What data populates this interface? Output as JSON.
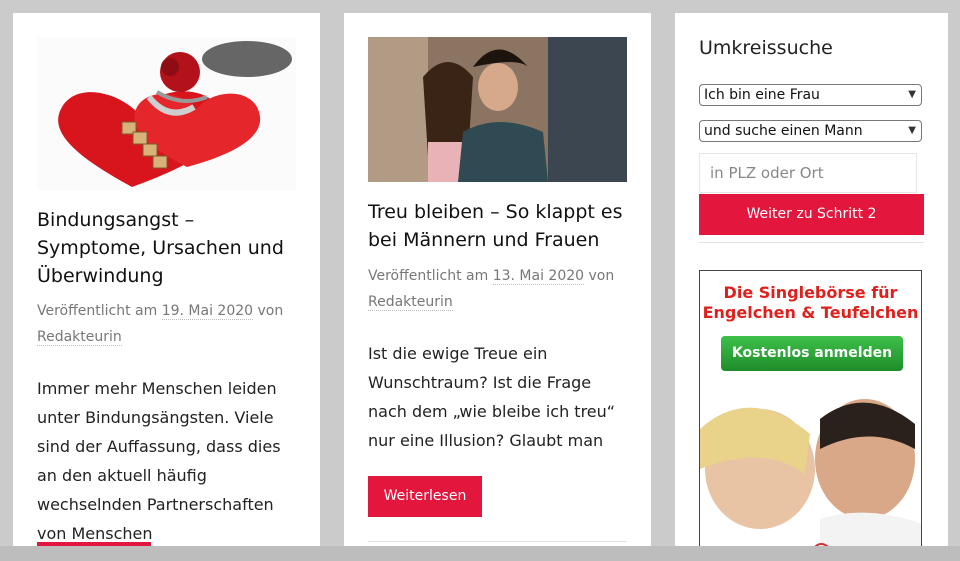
{
  "posts": [
    {
      "title": "Bindungsangst – Symptome, Ursachen und Überwindung",
      "meta_prefix": "Veröffentlicht am",
      "date": "19. Mai 2020",
      "meta_by": "von",
      "author": "Redakteurin",
      "excerpt": "Immer mehr Menschen leiden unter Bindungsängsten. Viele sind der Auffassung, dass dies an den aktuell häufig wechselnden Partnerschaften von Menschen",
      "button": ""
    },
    {
      "title": "Treu bleiben – So klappt es bei Männern und Frauen",
      "meta_prefix": "Veröffentlicht am",
      "date": "13. Mai 2020",
      "meta_by": "von",
      "author": "Redakteurin",
      "excerpt": "Ist die ewige Treue ein Wunschtraum? Ist die Frage nach dem „wie bleibe ich treu“ nur eine Illusion? Glaubt man",
      "button": "Weiterlesen"
    }
  ],
  "sidebar": {
    "title": "Umkreissuche",
    "select_gender": "Ich bin eine Frau",
    "select_seek": "und suche einen Mann",
    "location_placeholder": "in PLZ oder Ort",
    "submit": "Weiter zu Schritt 2"
  },
  "ad": {
    "headline_1": "Die Singlebörse für",
    "headline_2": "Engelchen & Teufelchen",
    "button": "Kostenlos anmelden"
  },
  "colors": {
    "accent": "#e3173e",
    "ad_green": "#2aa537",
    "background": "#cbcbcb"
  },
  "icons": {
    "select_arrow": "chevron-down-icon"
  }
}
